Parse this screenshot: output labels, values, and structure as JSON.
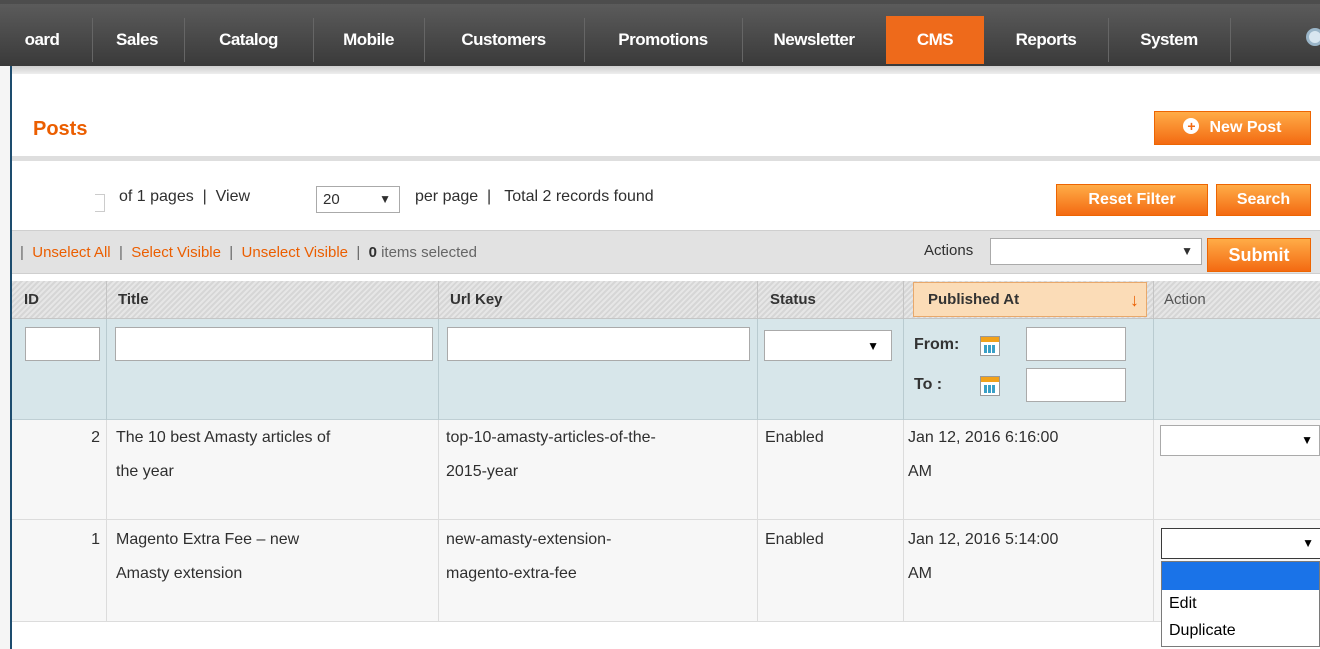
{
  "nav": {
    "items": [
      "oard",
      "Sales",
      "Catalog",
      "Mobile",
      "Customers",
      "Promotions",
      "Newsletter",
      "CMS",
      "Reports",
      "System"
    ],
    "active": "CMS",
    "colors": {
      "bar": "#4a4a4a",
      "active": "#ee6a1b"
    }
  },
  "page": {
    "title": "Posts",
    "new_button": "New Post",
    "accent": "#eb5e00"
  },
  "pager": {
    "text": "of 1 pages  |  View",
    "per_page_value": "20",
    "after": "per page  |   Total 2 records found",
    "reset_filter": "Reset Filter",
    "search": "Search"
  },
  "massaction": {
    "unselect_all": "Unselect All",
    "select_visible": "Select Visible",
    "unselect_visible": "Unselect Visible",
    "count": "0",
    "selected_suffix": "items selected",
    "actions_label": "Actions",
    "submit": "Submit"
  },
  "columns": {
    "id": "ID",
    "title": "Title",
    "url_key": "Url Key",
    "status": "Status",
    "published_at": "Published At",
    "action": "Action"
  },
  "filters": {
    "from": "From:",
    "to": "To :"
  },
  "rows": [
    {
      "id": "2",
      "title_1": "The 10 best Amasty articles of",
      "title_2": "the year",
      "url_1": "top-10-amasty-articles-of-the-",
      "url_2": "2015-year",
      "status": "Enabled",
      "date_1": "Jan 12, 2016 6:16:00",
      "date_2": "AM"
    },
    {
      "id": "1",
      "title_1": "Magento Extra Fee – new",
      "title_2": "Amasty extension",
      "url_1": "new-amasty-extension-",
      "url_2": "magento-extra-fee",
      "status": "Enabled",
      "date_1": "Jan 12, 2016 5:14:00",
      "date_2": "AM"
    }
  ],
  "action_dropdown": {
    "options": [
      "",
      "Edit",
      "Duplicate"
    ]
  }
}
